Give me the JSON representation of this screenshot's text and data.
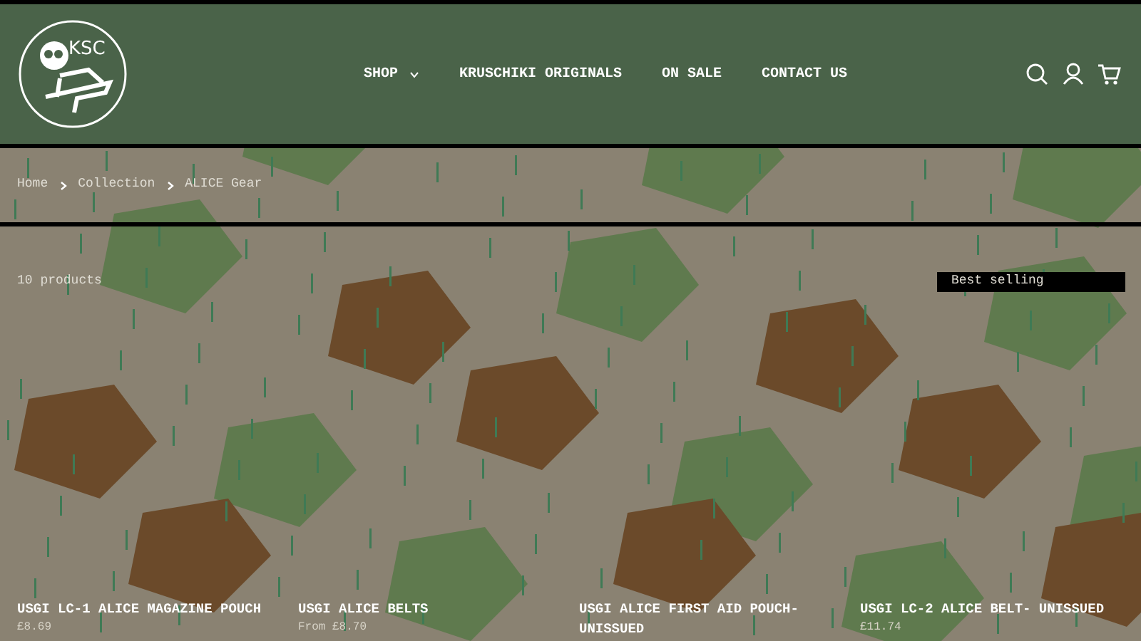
{
  "header": {
    "logo": "KSC",
    "nav": [
      {
        "label": "SHOP",
        "dropdown": true
      },
      {
        "label": "KRUSCHIKI ORIGINALS",
        "dropdown": false
      },
      {
        "label": "ON SALE",
        "dropdown": false
      },
      {
        "label": "CONTACT US",
        "dropdown": false
      }
    ]
  },
  "breadcrumb": [
    "Home",
    "Collection",
    "ALICE Gear"
  ],
  "product_count": "10 products",
  "sort": {
    "value": "Best selling"
  },
  "products": [
    {
      "title": "USGI LC-1 ALICE MAGAZINE POUCH",
      "price": "£8.69"
    },
    {
      "title": "USGI ALICE BELTS",
      "price": "From £8.70"
    },
    {
      "title": "USGI ALICE FIRST AID POUCH- UNISSUED"
    },
    {
      "title": "USGI LC-2 ALICE BELT- UNISSUED",
      "price": "£11.74"
    }
  ]
}
